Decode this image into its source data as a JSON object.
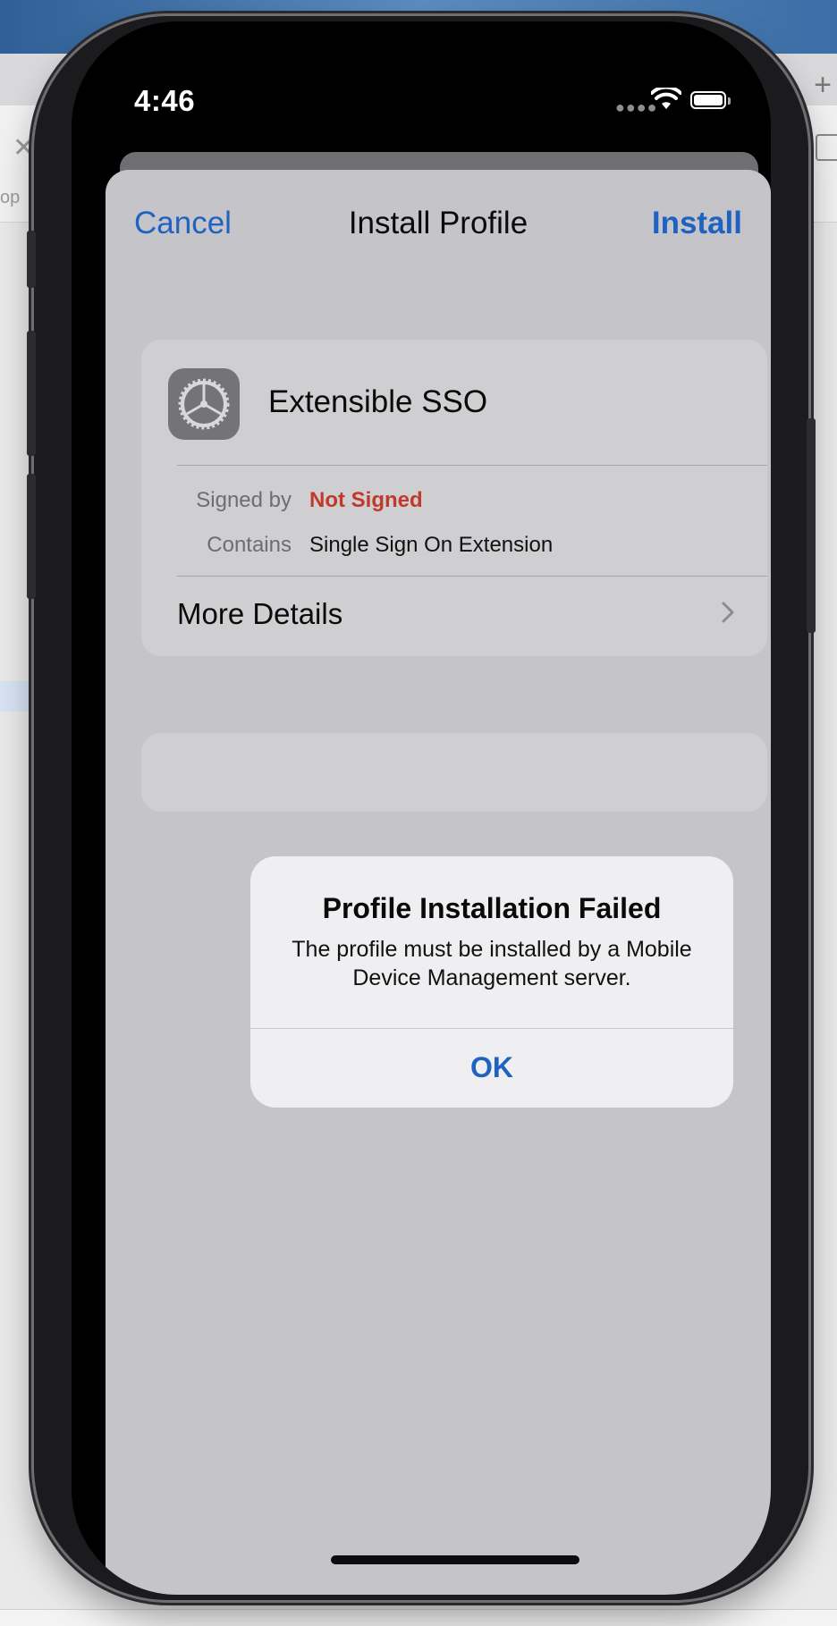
{
  "status_bar": {
    "time": "4:46",
    "signal_icon": "signal-dots-icon",
    "wifi_icon": "wifi-icon",
    "battery_icon": "battery-icon"
  },
  "nav": {
    "cancel_label": "Cancel",
    "title": "Install Profile",
    "install_label": "Install"
  },
  "profile": {
    "name": "Extensible SSO",
    "icon": "settings-gear-icon",
    "signed_by_label": "Signed by",
    "signed_by_value": "Not Signed",
    "contains_label": "Contains",
    "contains_value": "Single Sign On Extension",
    "more_details_label": "More Details"
  },
  "alert": {
    "title": "Profile Installation Failed",
    "message": "The profile must be installed by a Mobile Device Management server.",
    "ok_label": "OK"
  },
  "background_browser": {
    "op_text": "op"
  },
  "colors": {
    "accent": "#1f62c2",
    "error": "#c0392b",
    "sheet_bg": "#c4c4c9",
    "alert_bg": "#efeff1"
  }
}
